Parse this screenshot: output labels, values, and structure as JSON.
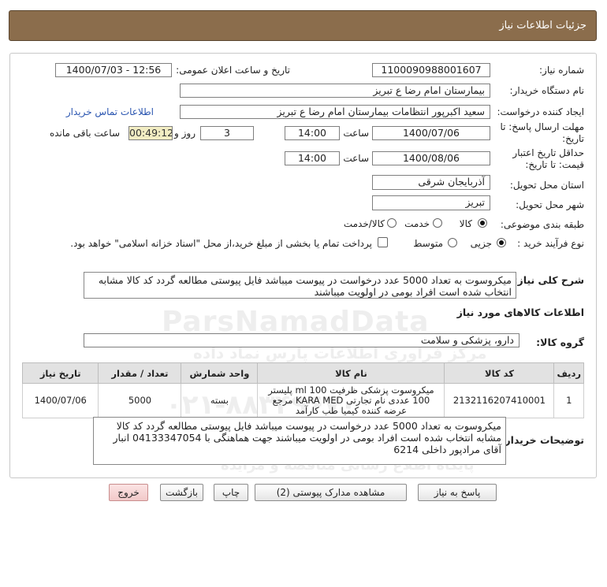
{
  "header": {
    "title": "جزئیات اطلاعات نیاز"
  },
  "labels": {
    "need_number": "شماره نیاز:",
    "announce_datetime": "تاریخ و ساعت اعلان عمومی:",
    "buyer_org": "نام دستگاه خریدار:",
    "requester": "ایجاد کننده درخواست:",
    "buyer_contact": "اطلاعات تماس خریدار",
    "reply_deadline": "مهلت ارسال پاسخ: تا تاریخ:",
    "time": "ساعت",
    "day_and": "روز و",
    "remaining": "ساعت باقی مانده",
    "price_validity": "حداقل تاریخ اعتبار قیمت: تا تاریخ:",
    "delivery_province": "استان محل تحویل:",
    "delivery_city": "شهر محل تحویل:",
    "category": "طبقه بندی موضوعی:",
    "purchase_type": "نوع فرآیند خرید :",
    "general_description": "شرح کلی نیاز:",
    "goods_info": "اطلاعات کالاهای مورد نیاز",
    "goods_group": "گروه کالا:",
    "buyer_notes": "توضیحات خریدار:"
  },
  "values": {
    "need_number": "1100090988001607",
    "announce_datetime": "1400/07/03 - 12:56",
    "buyer_org": "بیمارستان امام رضا  ع  تبریز",
    "requester": "سعید اکبرپور انتظامات بیمارستان امام رضا  ع  تبریز",
    "reply_date": "1400/07/06",
    "reply_time": "14:00",
    "days": "3",
    "remaining_time": "00:49:12",
    "validity_date": "1400/08/06",
    "validity_time": "14:00",
    "province": "آذربایجان شرقی",
    "city": "تبریز",
    "goods_group": "دارو، پزشکی و سلامت",
    "general_description": "میکروسوت به تعداد 5000 عدد درخواست در پیوست میباشد فایل پیوستی مطالعه گردد کد کالا مشابه انتخاب شده است افراد بومی در اولویت میباشند",
    "buyer_notes": "میکروسوت به تعداد 5000 عدد درخواست در پیوست میباشد فایل پیوستی مطالعه گردد کد کالا مشابه انتخاب شده است افراد بومی در اولویت میباشند جهت هماهنگی با 04133347054 انبار آقای مرادپور داخلی 6214"
  },
  "category_options": [
    {
      "label": "کالا",
      "selected": true
    },
    {
      "label": "خدمت",
      "selected": false
    },
    {
      "label": "کالا/خدمت",
      "selected": false
    }
  ],
  "purchase_options": [
    {
      "label": "جزیی",
      "selected": true
    },
    {
      "label": "متوسط",
      "selected": false
    }
  ],
  "treasury_note": "پرداخت تمام یا بخشی از مبلغ خرید،از محل \"اسناد خزانه اسلامی\" خواهد بود.",
  "table": {
    "headers": [
      "ردیف",
      "کد کالا",
      "نام کالا",
      "واحد شمارش",
      "تعداد / مقدار",
      "تاریخ نیاز"
    ],
    "rows": [
      {
        "index": "1",
        "code": "2132116207410001",
        "name": "میکروسوت پزشکی ظرفیت ml 100 پلیستر 100 عددی نام تجارتی KARA MED مرجع عرضه کننده کیمیا طب کارآمد",
        "unit": "بسته",
        "qty": "5000",
        "date": "1400/07/06"
      }
    ]
  },
  "buttons": {
    "reply": "پاسخ به نیاز",
    "attachments": "مشاهده مدارک پیوستی (2)",
    "print": "چاپ",
    "back": "بازگشت",
    "exit": "خروج"
  },
  "watermark": {
    "brand": "ParsNamadData",
    "subtitle": "مرکز فراوری اطلاعات پارس نماد داده",
    "line2": "پایگاه اطلاع رسانی مناقصه و مزایده",
    "phone": "۰۲۱-۸۸۳۴۹۶۷۰"
  }
}
